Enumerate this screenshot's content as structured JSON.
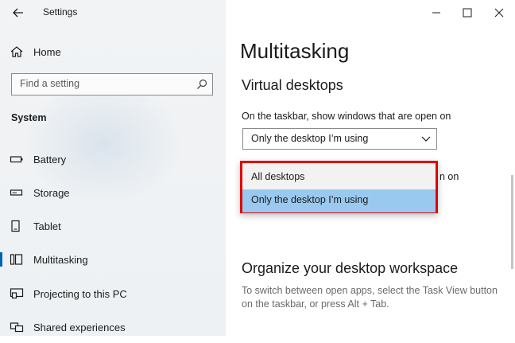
{
  "window": {
    "app_title": "Settings"
  },
  "sidebar": {
    "home_label": "Home",
    "search_placeholder": "Find a setting",
    "group_label": "System",
    "items": [
      {
        "label": "Battery",
        "icon": "battery-icon"
      },
      {
        "label": "Storage",
        "icon": "storage-icon"
      },
      {
        "label": "Tablet",
        "icon": "tablet-icon"
      },
      {
        "label": "Multitasking",
        "icon": "multitasking-icon",
        "selected": true
      },
      {
        "label": "Projecting to this PC",
        "icon": "projecting-icon"
      },
      {
        "label": "Shared experiences",
        "icon": "shared-experiences-icon"
      }
    ]
  },
  "main": {
    "page_title": "Multitasking",
    "section1_title": "Virtual desktops",
    "taskbar_setting_label": "On the taskbar, show windows that are open on",
    "taskbar_setting_value": "Only the desktop I’m using",
    "partially_hidden_text": "n on",
    "section2_title": "Organize your desktop workspace",
    "section2_desc": "To switch between open apps, select the Task View button on the taskbar, or press Alt + Tab."
  },
  "dropdown": {
    "options": [
      {
        "label": "All desktops",
        "selected": false
      },
      {
        "label": "Only the desktop I’m using",
        "selected": true
      }
    ],
    "highlight_color": "#e00000",
    "selected_color": "#99c9ef"
  },
  "colors": {
    "accent": "#0063b1"
  }
}
